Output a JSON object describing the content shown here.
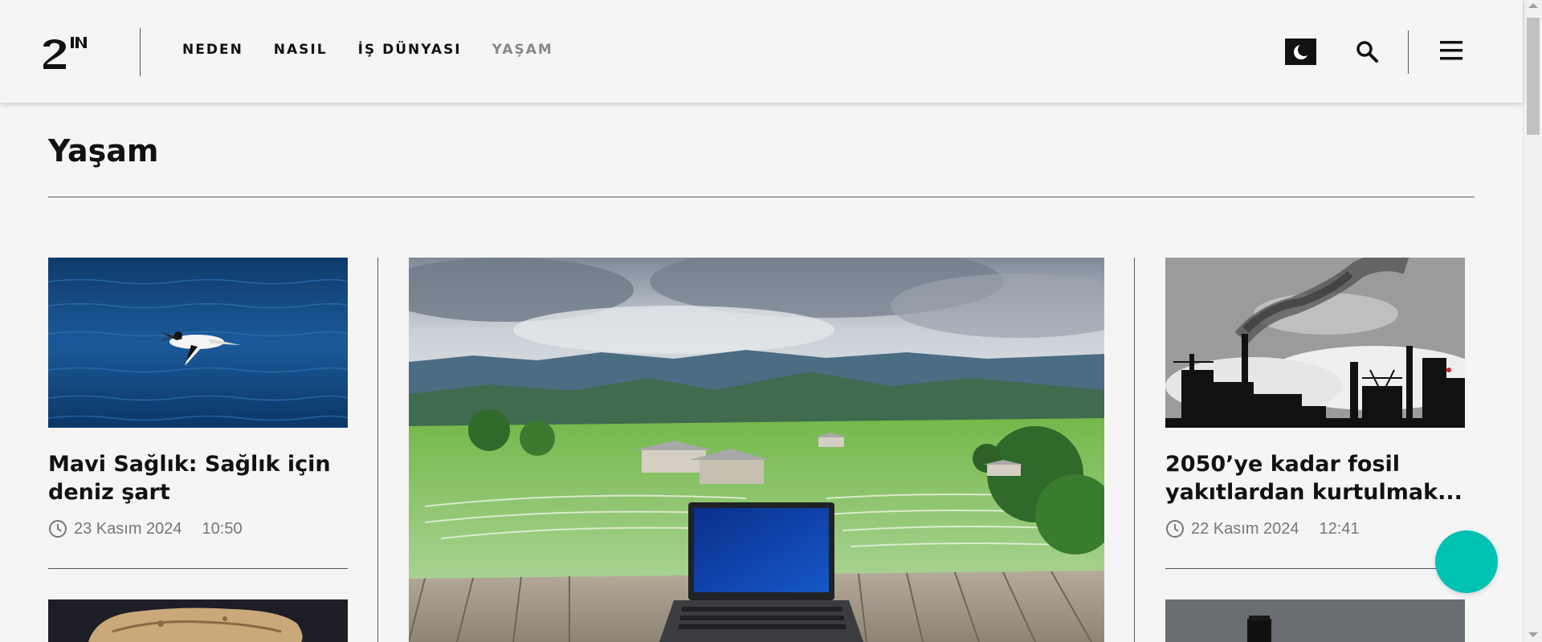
{
  "header": {
    "logo_alt": "2N",
    "nav": [
      {
        "label": "NEDEN",
        "active": false
      },
      {
        "label": "NASIL",
        "active": false
      },
      {
        "label": "İŞ DÜNYASI",
        "active": false
      },
      {
        "label": "YAŞAM",
        "active": true
      }
    ],
    "icons": [
      "moon-icon",
      "search-icon",
      "hamburger-menu-icon"
    ]
  },
  "page": {
    "title": "Yaşam"
  },
  "articles": [
    {
      "title": "Mavi Sağlık: Sağlık için deniz şart",
      "date": "23 Kasım 2024",
      "time": "10:50",
      "image": "bird-over-sea"
    },
    {
      "title": "",
      "image": "laptop-rice-terraces"
    },
    {
      "title": "2050’ye kadar fosil yakıtlardan kurtulmak...",
      "date": "22 Kasım 2024",
      "time": "12:41",
      "image": "industrial-smokestacks"
    }
  ],
  "colors": {
    "background": "#f5f5f5",
    "accent": "#00c2b2",
    "nav_active": "#888888"
  }
}
